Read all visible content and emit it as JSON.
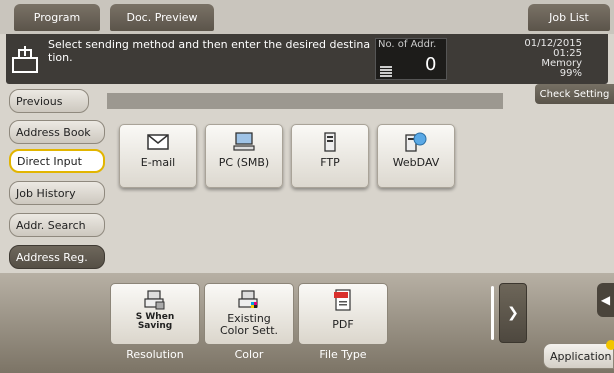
{
  "top_tabs": {
    "program": "Program",
    "doc_preview": "Doc. Preview",
    "job_list": "Job List"
  },
  "message": {
    "text": "Select sending method and then enter the desired destination.",
    "no_of_addr_label": "No. of Addr.",
    "no_of_addr_value": "0",
    "date": "01/12/2015",
    "time": "01:25",
    "memory_label": "Memory",
    "memory_value": "99%"
  },
  "sidebar": {
    "previous": "Previous",
    "items": [
      {
        "label": "Address Book",
        "active": false
      },
      {
        "label": "Direct Input",
        "active": true
      },
      {
        "label": "Job History",
        "active": false
      },
      {
        "label": "Addr. Search",
        "active": false
      },
      {
        "label": "Address Reg.",
        "active": false
      }
    ]
  },
  "check_setting": "Check Setting",
  "destinations": [
    {
      "label": "E-mail",
      "icon": "envelope-icon"
    },
    {
      "label": "PC (SMB)",
      "icon": "computer-icon"
    },
    {
      "label": "FTP",
      "icon": "ftp-server-icon"
    },
    {
      "label": "WebDAV",
      "icon": "webdav-icon"
    }
  ],
  "options": [
    {
      "label": "Resolution",
      "value_line1": "S When",
      "value_line2": "Saving",
      "icon": "resolution-icon"
    },
    {
      "label": "Color",
      "value_line1": "Existing",
      "value_line2": "Color Sett.",
      "icon": "color-icon"
    },
    {
      "label": "File Type",
      "value_line1": "PDF",
      "value_line2": "",
      "icon": "pdf-icon"
    }
  ],
  "application": "Application",
  "colors": {
    "active_border": "#e2b500",
    "dark_bar": "#3e3b37",
    "bottom_strip": "#7c7466"
  }
}
